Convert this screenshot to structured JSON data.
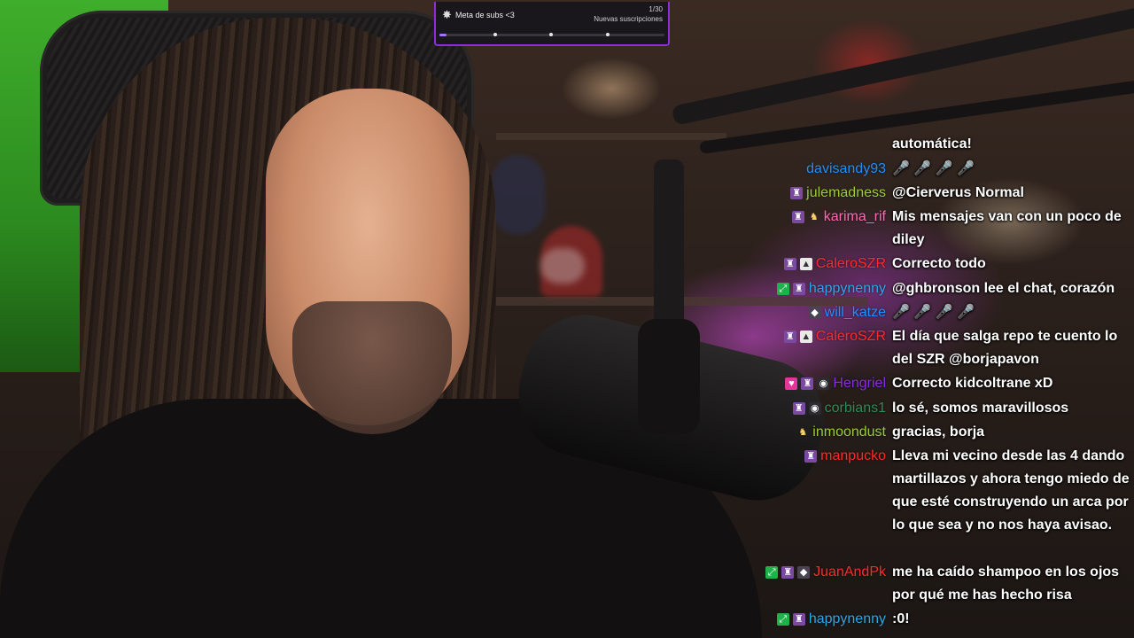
{
  "sub_goal": {
    "title": "Meta de subs <3",
    "progress_text": "1/30",
    "subtitle": "Nuevas suscripciones",
    "progress_fraction": 0.033,
    "accent_color": "#8b2fd9",
    "icon": "star-badge-icon"
  },
  "chat": {
    "messages": [
      {
        "user": "",
        "user_color": "#ffffff",
        "badges": [],
        "text": "automática!"
      },
      {
        "user": "davisandy93",
        "user_color": "#1e90ff",
        "badges": [],
        "text": "🎤 🎤 🎤 🎤"
      },
      {
        "user": "julemadness",
        "user_color": "#9acd32",
        "badges": [
          "tier"
        ],
        "text": "@Cierverus Normal"
      },
      {
        "user": "karima_rif",
        "user_color": "#ff69b4",
        "badges": [
          "tier",
          "gold"
        ],
        "text": "Mis mensajes van con un poco de diley"
      },
      {
        "user": "CaleroSZR",
        "user_color": "#ff2a2a",
        "badges": [
          "tier",
          "mod"
        ],
        "text": "Correcto todo"
      },
      {
        "user": "happynenny",
        "user_color": "#2aa7e6",
        "badges": [
          "sub",
          "tier"
        ],
        "text": "@ghbronson lee el chat, corazón"
      },
      {
        "user": "will_katze",
        "user_color": "#1e90ff",
        "badges": [
          "emote"
        ],
        "text": "🎤 🎤 🎤 🎤"
      },
      {
        "user": "CaleroSZR",
        "user_color": "#ff2a2a",
        "badges": [
          "tier",
          "mod"
        ],
        "text": "El día que salga repo te cuento lo del SZR @borjapavon"
      },
      {
        "user": "Hengriel",
        "user_color": "#8a2be2",
        "badges": [
          "heart",
          "tier",
          "dark"
        ],
        "text": "Correcto kidcoltrane xD"
      },
      {
        "user": "corbians1",
        "user_color": "#2e8b57",
        "badges": [
          "tier",
          "dark"
        ],
        "text": "lo sé, somos maravillosos"
      },
      {
        "user": "inmoondust",
        "user_color": "#9acd32",
        "badges": [
          "gold"
        ],
        "text": "gracias, borja"
      },
      {
        "user": "manpucko",
        "user_color": "#ff2a2a",
        "badges": [
          "tier"
        ],
        "text": "Lleva mi vecino desde las 4 dando martillazos y ahora tengo miedo de que esté construyendo un arca por lo que sea y no nos haya avisao."
      },
      {
        "user": "JuanAndPk",
        "user_color": "#ff2a2a",
        "badges": [
          "sub",
          "tier",
          "emote"
        ],
        "text": "me ha caído shampoo en los ojos por qué me has hecho risa"
      },
      {
        "user": "happynenny",
        "user_color": "#2aa7e6",
        "badges": [
          "sub",
          "tier"
        ],
        "text": ":0!"
      }
    ]
  }
}
